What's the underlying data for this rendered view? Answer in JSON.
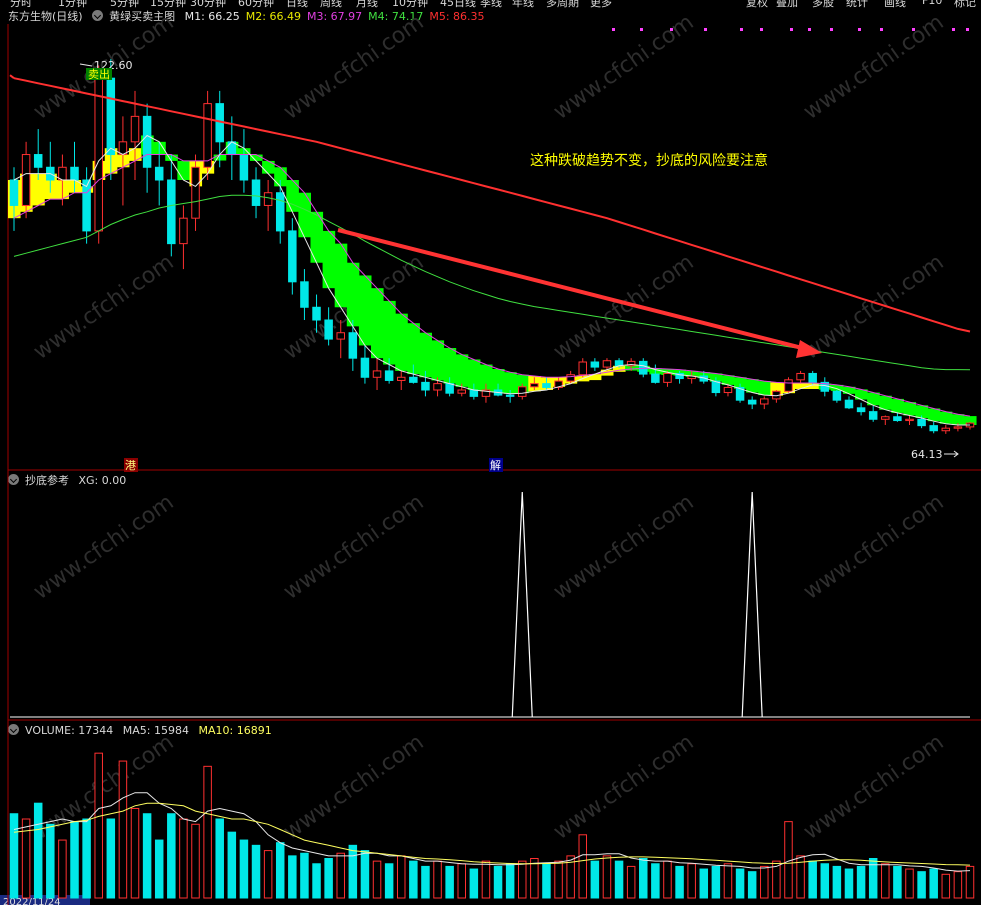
{
  "top_menu": [
    "分时",
    "1分钟",
    "5分钟",
    "15分钟",
    "30分钟",
    "60分钟",
    "日线",
    "周线",
    "月线",
    "10分钟",
    "45日线",
    "季线",
    "年线",
    "多周期",
    "更多",
    "复权",
    "叠加",
    "多股",
    "统计",
    "画线",
    "F10",
    "标记"
  ],
  "main_header": {
    "security": "东方生物(日线)",
    "indicator": "黄绿买卖主图",
    "ma": [
      {
        "label": "M1: 66.25",
        "color": "#e8e8e8"
      },
      {
        "label": "M2: 66.49",
        "color": "#e8e800"
      },
      {
        "label": "M3: 67.97",
        "color": "#e040e0"
      },
      {
        "label": "M4: 74.17",
        "color": "#40e040"
      },
      {
        "label": "M5: 86.35",
        "color": "#ff3030"
      }
    ]
  },
  "annotations": {
    "high_label": "122.60",
    "sell_label": "卖出",
    "low_label": "64.13",
    "comment": "这种跌破趋势不变，抄底的风险要注意",
    "marker_gang": "港",
    "marker_jie": "解"
  },
  "sub1_header": {
    "name": "抄底参考",
    "value": "XG: 0.00"
  },
  "sub2_header": {
    "name": "VOLUME: 17344",
    "ma5": "MA5: 15984",
    "ma10": "MA10: 16891"
  },
  "bottom_date": "2022/11/24",
  "colors": {
    "up": "#ff3030",
    "down": "#00e8e8",
    "ma1": "#e8e8e8",
    "ma3": "#e040e0",
    "ma4": "#40e040",
    "ma5": "#ff3030",
    "ribbon_yellow": "#ffff00",
    "ribbon_green": "#00ff00",
    "text_yellow": "#ffff00",
    "arrow": "#ff3333"
  },
  "watermark": "www.cfchi.com",
  "chart_data": [
    {
      "type": "candlestick",
      "title": "黄绿买卖主图",
      "ylim": [
        60,
        126
      ],
      "candles": [
        [
          104,
          106,
          96,
          100
        ],
        [
          100,
          110,
          98,
          108
        ],
        [
          108,
          112,
          104,
          106
        ],
        [
          106,
          110,
          102,
          104
        ],
        [
          104,
          108,
          100,
          106
        ],
        [
          106,
          110,
          102,
          104
        ],
        [
          104,
          106,
          94,
          96
        ],
        [
          96,
          122,
          94,
          120
        ],
        [
          120,
          123,
          104,
          108
        ],
        [
          108,
          114,
          100,
          110
        ],
        [
          110,
          118,
          104,
          114
        ],
        [
          114,
          116,
          102,
          106
        ],
        [
          106,
          110,
          100,
          104
        ],
        [
          104,
          108,
          92,
          94
        ],
        [
          94,
          100,
          90,
          98
        ],
        [
          98,
          108,
          96,
          106
        ],
        [
          106,
          118,
          104,
          116
        ],
        [
          116,
          118,
          106,
          110
        ],
        [
          110,
          114,
          104,
          108
        ],
        [
          108,
          112,
          102,
          104
        ],
        [
          104,
          106,
          98,
          100
        ],
        [
          100,
          104,
          96,
          102
        ],
        [
          102,
          104,
          94,
          96
        ],
        [
          96,
          98,
          86,
          88
        ],
        [
          88,
          90,
          82,
          84
        ],
        [
          84,
          86,
          80,
          82
        ],
        [
          82,
          84,
          78,
          79
        ],
        [
          79,
          82,
          76,
          80
        ],
        [
          80,
          82,
          74,
          76
        ],
        [
          76,
          78,
          72,
          73
        ],
        [
          73,
          76,
          71,
          74
        ],
        [
          74,
          76,
          72,
          72.5
        ],
        [
          72.5,
          74,
          71,
          73
        ],
        [
          73,
          75,
          72,
          72.2
        ],
        [
          72.2,
          74,
          70,
          71
        ],
        [
          71,
          73,
          70,
          72
        ],
        [
          72,
          73,
          70,
          70.5
        ],
        [
          70.5,
          72,
          70,
          71
        ],
        [
          71,
          72,
          69.5,
          70
        ],
        [
          70,
          72,
          69,
          71
        ],
        [
          71,
          72,
          70,
          70.2
        ],
        [
          70.2,
          71,
          69,
          70
        ],
        [
          70,
          72,
          69.5,
          71.5
        ],
        [
          71.5,
          73,
          71,
          72
        ],
        [
          72,
          73,
          71,
          71.4
        ],
        [
          71.4,
          73,
          71,
          72.4
        ],
        [
          72.4,
          74,
          72,
          73.4
        ],
        [
          73.4,
          76,
          73,
          75.4
        ],
        [
          75.4,
          76,
          74,
          74.6
        ],
        [
          74.6,
          76,
          74,
          75.6
        ],
        [
          75.6,
          76,
          74.5,
          74.8
        ],
        [
          74.8,
          76,
          74,
          75.5
        ],
        [
          75.5,
          76,
          73,
          73.5
        ],
        [
          73.5,
          75,
          72,
          72.2
        ],
        [
          72.2,
          74,
          71.5,
          73.6
        ],
        [
          73.6,
          74,
          72,
          72.8
        ],
        [
          72.8,
          74,
          72,
          73.2
        ],
        [
          73.2,
          74,
          72,
          72.4
        ],
        [
          72.4,
          73,
          70,
          70.6
        ],
        [
          70.6,
          72,
          70,
          71.4
        ],
        [
          71.4,
          72,
          69,
          69.4
        ],
        [
          69.4,
          70,
          68,
          68.8
        ],
        [
          68.8,
          70,
          68,
          69.6
        ],
        [
          69.6,
          71,
          69,
          70.8
        ],
        [
          70.8,
          73,
          70.5,
          72.6
        ],
        [
          72.6,
          74,
          72,
          73.6
        ],
        [
          73.6,
          74,
          71.8,
          72.2
        ],
        [
          72.2,
          73,
          70,
          70.8
        ],
        [
          70.8,
          71,
          69,
          69.4
        ],
        [
          69.4,
          70,
          68,
          68.2
        ],
        [
          68.2,
          69,
          67,
          67.6
        ],
        [
          67.6,
          68.5,
          66,
          66.4
        ],
        [
          66.4,
          67,
          65.5,
          66.8
        ],
        [
          66.8,
          67.5,
          66,
          66.2
        ],
        [
          66.2,
          67,
          65.5,
          66.4
        ],
        [
          66.4,
          67,
          65,
          65.4
        ],
        [
          65.4,
          66,
          64.2,
          64.6
        ],
        [
          64.6,
          65.5,
          64.1,
          65
        ],
        [
          65,
          65.8,
          64.5,
          65.2
        ],
        [
          65.2,
          66,
          64.8,
          65.8
        ]
      ],
      "ma1": [
        104,
        105,
        105,
        105,
        104,
        104,
        103,
        107,
        109,
        108,
        109,
        111,
        110,
        107,
        104,
        103,
        105,
        108,
        110,
        109,
        107,
        105,
        103,
        99,
        95,
        91,
        87,
        84,
        81,
        78,
        76,
        75,
        74,
        73.5,
        73,
        72.5,
        72,
        71.5,
        71,
        70.8,
        70.6,
        70.4,
        70.5,
        70.8,
        71,
        71.5,
        72,
        72.8,
        73.5,
        74.2,
        74.8,
        75,
        74.8,
        74.2,
        73.8,
        73.4,
        73.2,
        72.9,
        72.3,
        71.8,
        71.2,
        70.6,
        70.2,
        70.1,
        70.5,
        71.2,
        71.8,
        71.7,
        71.2,
        70.4,
        69.5,
        68.6,
        67.9,
        67.4,
        67,
        66.6,
        66.1,
        65.7,
        65.5,
        65.5
      ],
      "ma3": [
        98,
        99,
        100,
        101,
        101,
        102,
        102,
        104,
        105,
        106,
        107,
        108,
        108,
        108,
        107,
        107,
        107,
        108,
        108,
        108,
        108,
        107,
        106,
        104,
        102,
        99,
        96,
        94,
        91,
        89,
        87,
        85,
        83,
        81.5,
        80,
        78.8,
        77.6,
        76.6,
        75.8,
        75,
        74.3,
        73.8,
        73.4,
        73.2,
        73,
        73,
        73.1,
        73.3,
        73.5,
        73.8,
        74.1,
        74.3,
        74.4,
        74.4,
        74.3,
        74.2,
        74,
        73.8,
        73.6,
        73.3,
        73,
        72.7,
        72.4,
        72.2,
        72.1,
        72.1,
        72.1,
        72,
        71.8,
        71.5,
        71.1,
        70.6,
        70.1,
        69.6,
        69.1,
        68.6,
        68.1,
        67.6,
        67.2,
        66.9
      ],
      "ma4": [
        92,
        92.5,
        93,
        93.5,
        94,
        94.5,
        95,
        96,
        97,
        97.8,
        98.5,
        99,
        99.6,
        100,
        100.3,
        100.6,
        101,
        101.4,
        101.6,
        101.6,
        101.5,
        101.2,
        100.8,
        100.2,
        99.4,
        98.5,
        97.5,
        96.5,
        95.5,
        94.4,
        93.4,
        92.4,
        91.4,
        90.5,
        89.6,
        88.8,
        88,
        87.3,
        86.6,
        86,
        85.4,
        84.9,
        84.5,
        84.1,
        83.8,
        83.5,
        83.2,
        82.9,
        82.6,
        82.3,
        82,
        81.7,
        81.4,
        81.1,
        80.8,
        80.5,
        80.2,
        79.9,
        79.6,
        79.3,
        79,
        78.7,
        78.4,
        78.1,
        77.8,
        77.5,
        77.2,
        76.9,
        76.6,
        76.3,
        76,
        75.7,
        75.4,
        75.1,
        74.8,
        74.5,
        74.3,
        74.2,
        74.2,
        74.17
      ],
      "ma5": [
        120,
        119.6,
        119.2,
        118.8,
        118.4,
        118,
        117.6,
        117.2,
        116.8,
        116.4,
        116,
        115.6,
        115.2,
        114.8,
        114.4,
        114,
        113.6,
        113.2,
        112.8,
        112.4,
        112,
        111.6,
        111.2,
        110.8,
        110.4,
        110,
        109.5,
        109,
        108.5,
        108,
        107.5,
        107,
        106.5,
        106,
        105.5,
        105,
        104.5,
        104,
        103.5,
        103,
        102.5,
        102,
        101.5,
        101,
        100.5,
        100,
        99.5,
        99,
        98.5,
        98,
        97.4,
        96.8,
        96.2,
        95.6,
        95,
        94.4,
        93.8,
        93.2,
        92.6,
        92,
        91.4,
        90.8,
        90.2,
        89.6,
        89,
        88.4,
        87.8,
        87.2,
        86.6,
        86,
        85.4,
        84.8,
        84.2,
        83.6,
        83,
        82.4,
        81.8,
        81.2,
        80.6,
        80.2
      ],
      "ribbon_state": [
        "Y",
        "Y",
        "Y",
        "Y",
        "Y",
        "Y",
        "Y",
        "Y",
        "Y",
        "Y",
        "Y",
        "G",
        "G",
        "G",
        "G",
        "Y",
        "Y",
        "G",
        "G",
        "G",
        "G",
        "G",
        "G",
        "G",
        "G",
        "G",
        "G",
        "G",
        "G",
        "G",
        "G",
        "G",
        "G",
        "G",
        "G",
        "G",
        "G",
        "G",
        "G",
        "G",
        "G",
        "G",
        "G",
        "Y",
        "Y",
        "Y",
        "Y",
        "Y",
        "Y",
        "Y",
        "Y",
        "G",
        "G",
        "G",
        "G",
        "G",
        "G",
        "G",
        "G",
        "G",
        "G",
        "G",
        "G",
        "Y",
        "Y",
        "Y",
        "Y",
        "G",
        "G",
        "G",
        "G",
        "G",
        "G",
        "G",
        "G",
        "G",
        "G",
        "G",
        "G",
        "G"
      ]
    },
    {
      "type": "line",
      "title": "抄底参考",
      "ylim": [
        0,
        1
      ],
      "signal_days": [
        42,
        61
      ],
      "values_note": "XG spikes to 1 on signal days, else 0"
    },
    {
      "type": "bar",
      "title": "VOLUME",
      "ylim": [
        0,
        60000
      ],
      "volume": [
        32000,
        30000,
        36000,
        28000,
        22000,
        29000,
        30000,
        55000,
        30000,
        52000,
        34000,
        32000,
        22000,
        32000,
        30000,
        28000,
        50000,
        30000,
        25000,
        22000,
        20000,
        18000,
        21000,
        16000,
        17000,
        13000,
        15000,
        17000,
        20000,
        18000,
        14000,
        13000,
        16000,
        14000,
        12000,
        14000,
        12000,
        13000,
        11000,
        14000,
        12000,
        13000,
        14000,
        15000,
        13000,
        14000,
        16000,
        24000,
        14000,
        16000,
        14000,
        12000,
        15000,
        13000,
        14000,
        12000,
        13000,
        11000,
        12000,
        13000,
        11000,
        10000,
        12000,
        14000,
        29000,
        16000,
        14000,
        13000,
        12000,
        11000,
        12000,
        15000,
        13000,
        12000,
        11000,
        10000,
        11000,
        9000,
        10000,
        12000
      ],
      "ma5_line": [
        26000,
        27000,
        28000,
        29000,
        30000,
        29000,
        29000,
        34000,
        35000,
        38000,
        40000,
        40000,
        36000,
        34000,
        30000,
        29000,
        33000,
        34000,
        33000,
        32000,
        29000,
        24000,
        21000,
        19000,
        18000,
        17000,
        16000,
        16000,
        16000,
        17000,
        17000,
        16000,
        16000,
        15000,
        14000,
        14000,
        13500,
        13000,
        12800,
        12800,
        12600,
        12600,
        12800,
        13200,
        13400,
        13600,
        14400,
        16400,
        16400,
        16800,
        16800,
        15200,
        14400,
        14000,
        14000,
        13400,
        13200,
        12800,
        12400,
        12200,
        12000,
        11400,
        11400,
        12000,
        14000,
        15400,
        16400,
        16600,
        14800,
        13200,
        12600,
        12600,
        12600,
        12600,
        12200,
        12000,
        11400,
        10600,
        10200,
        10400
      ],
      "ma10_line": [
        25000,
        25500,
        26000,
        27000,
        28000,
        29000,
        29500,
        31000,
        32000,
        33000,
        35000,
        36000,
        36000,
        35500,
        35000,
        33000,
        32000,
        31000,
        30000,
        30000,
        29000,
        28000,
        26000,
        24000,
        22000,
        21000,
        20000,
        19000,
        18000,
        17500,
        17000,
        16500,
        16000,
        15500,
        15000,
        14800,
        14500,
        14200,
        13800,
        13500,
        13300,
        13100,
        13000,
        13000,
        13100,
        13200,
        13600,
        14200,
        14800,
        15200,
        15500,
        15600,
        15600,
        15500,
        15300,
        15100,
        14900,
        14600,
        14300,
        14000,
        13700,
        13400,
        13200,
        13100,
        13200,
        13600,
        14000,
        14300,
        14500,
        14500,
        14300,
        14000,
        13700,
        13500,
        13300,
        13100,
        12900,
        12700,
        12600,
        12500
      ]
    }
  ]
}
